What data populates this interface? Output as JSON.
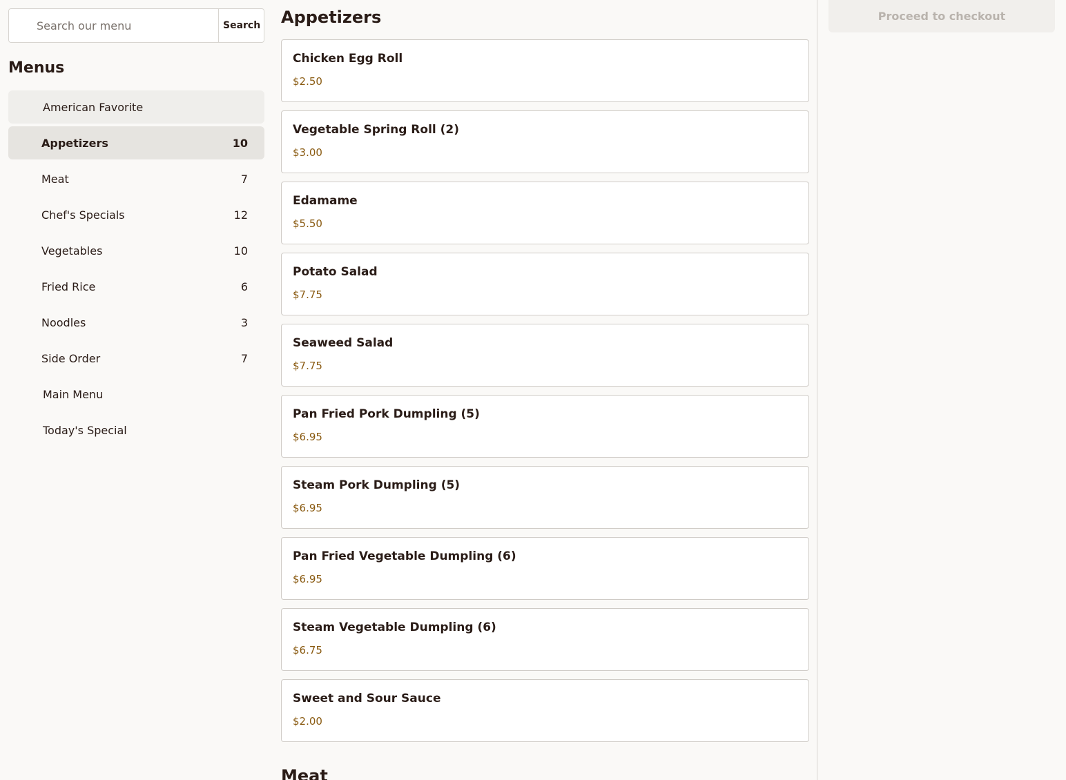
{
  "search": {
    "placeholder": "Search our menu",
    "button_label": "Search"
  },
  "sidebar": {
    "title": "Menus",
    "items": [
      {
        "label": "American Favorite",
        "count": "",
        "kind": "top",
        "style": "shaded"
      },
      {
        "label": "Appetizers",
        "count": "10",
        "kind": "sub",
        "style": "active"
      },
      {
        "label": "Meat",
        "count": "7",
        "kind": "sub",
        "style": ""
      },
      {
        "label": "Chef's Specials",
        "count": "12",
        "kind": "sub",
        "style": ""
      },
      {
        "label": "Vegetables",
        "count": "10",
        "kind": "sub",
        "style": ""
      },
      {
        "label": "Fried Rice",
        "count": "6",
        "kind": "sub",
        "style": ""
      },
      {
        "label": "Noodles",
        "count": "3",
        "kind": "sub",
        "style": ""
      },
      {
        "label": "Side Order",
        "count": "7",
        "kind": "sub",
        "style": ""
      },
      {
        "label": "Main Menu",
        "count": "",
        "kind": "top",
        "style": ""
      },
      {
        "label": "Today's Special",
        "count": "",
        "kind": "top",
        "style": ""
      }
    ]
  },
  "main": {
    "sections": [
      {
        "title": "Appetizers",
        "items": [
          {
            "name": "Chicken Egg Roll",
            "price": "$2.50"
          },
          {
            "name": "Vegetable Spring Roll (2)",
            "price": "$3.00"
          },
          {
            "name": "Edamame",
            "price": "$5.50"
          },
          {
            "name": "Potato Salad",
            "price": "$7.75"
          },
          {
            "name": "Seaweed Salad",
            "price": "$7.75"
          },
          {
            "name": "Pan Fried Pork Dumpling (5)",
            "price": "$6.95"
          },
          {
            "name": "Steam Pork Dumpling (5)",
            "price": "$6.95"
          },
          {
            "name": "Pan Fried Vegetable Dumpling (6)",
            "price": "$6.95"
          },
          {
            "name": "Steam Vegetable Dumpling (6)",
            "price": "$6.75"
          },
          {
            "name": "Sweet and Sour Sauce",
            "price": "$2.00"
          }
        ]
      },
      {
        "title": "Meat",
        "items": []
      }
    ]
  },
  "cart": {
    "checkout_label": "Proceed to checkout"
  },
  "colors": {
    "background": "#faf9f7",
    "price": "#8a5b12",
    "active_item": "#e6e4e0",
    "checkout_disabled_text": "#b9b3ad"
  }
}
